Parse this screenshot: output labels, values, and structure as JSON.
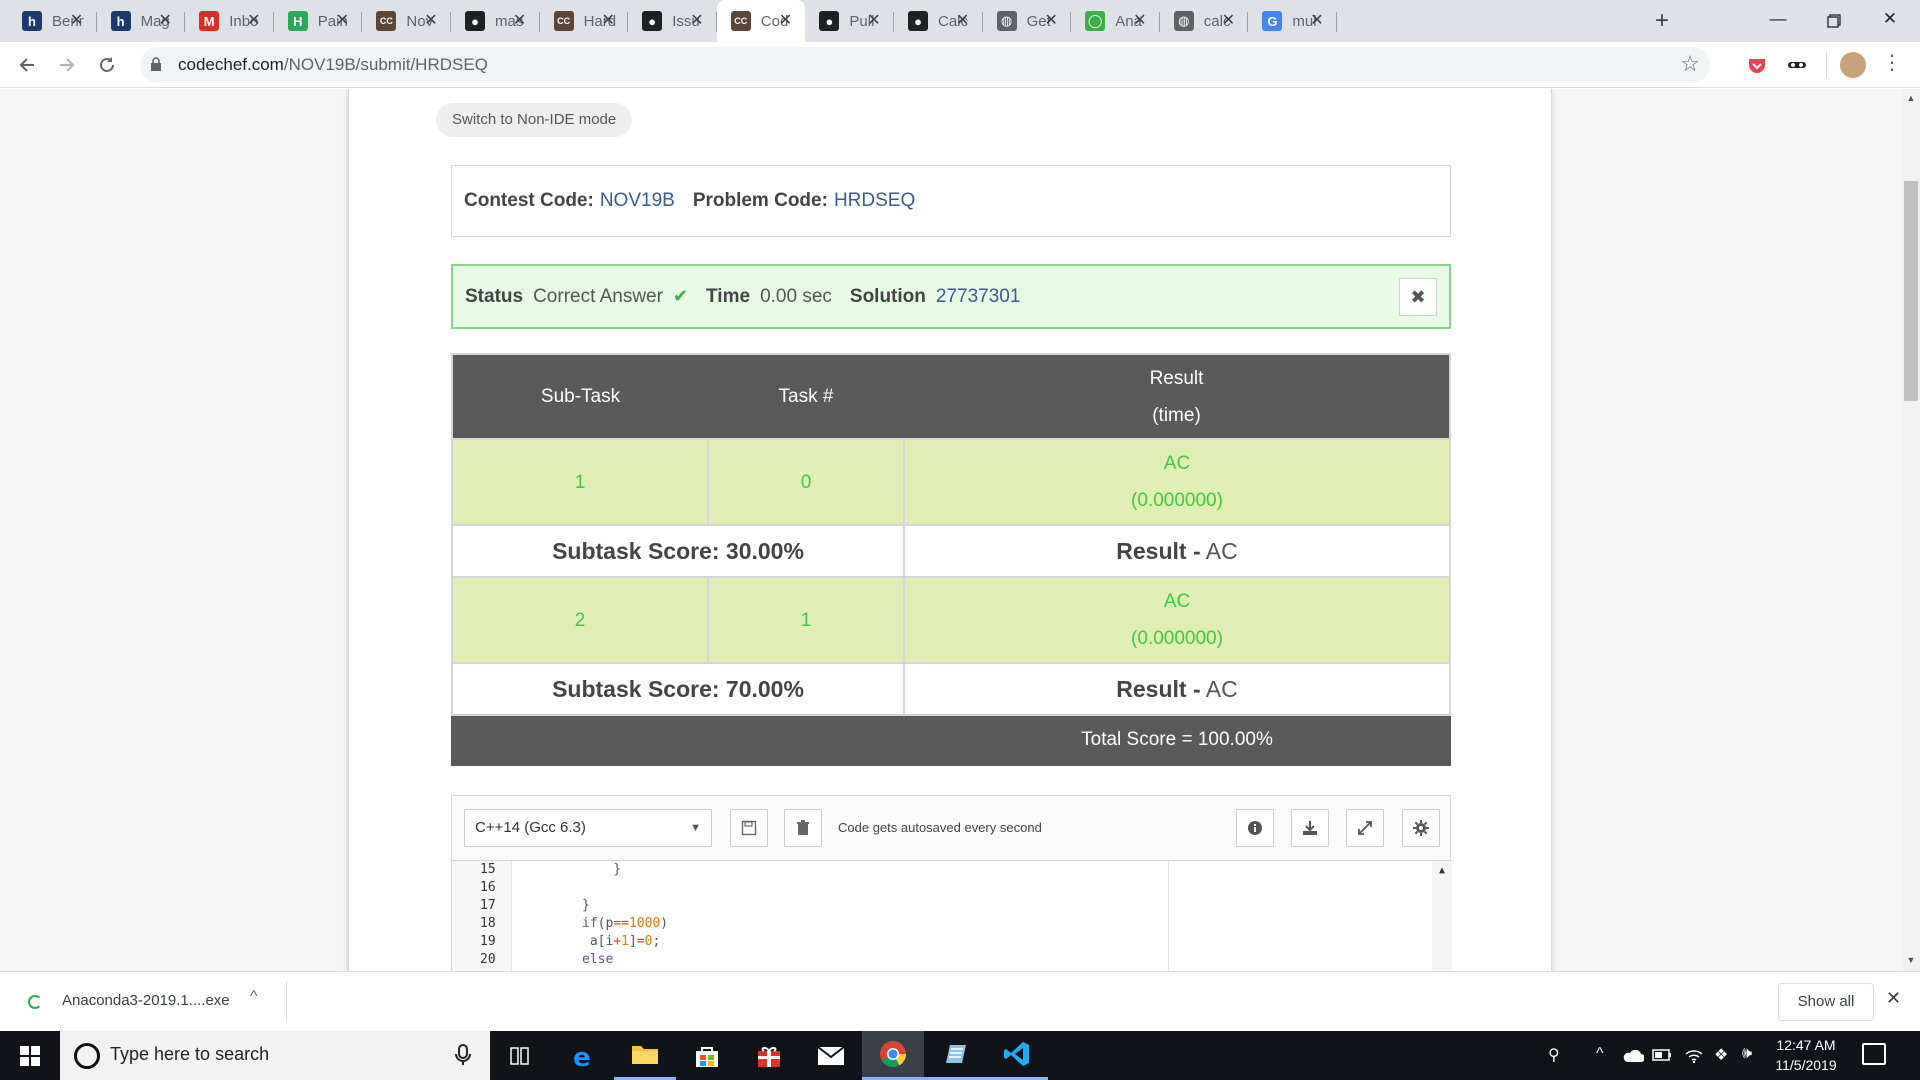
{
  "browser": {
    "tabs": [
      {
        "title": "Benn",
        "icon": "hashnode-icon",
        "color": "#1a3a6e"
      },
      {
        "title": "Mag",
        "icon": "hashnode-icon",
        "color": "#1a3a6e"
      },
      {
        "title": "Inbo",
        "icon": "gmail-icon",
        "color": "#d93025"
      },
      {
        "title": "Pain",
        "icon": "h-icon",
        "color": "#2ca85a"
      },
      {
        "title": "Nov",
        "icon": "codechef-icon",
        "color": "#5b4638"
      },
      {
        "title": "mas",
        "icon": "github-icon",
        "color": "#202124"
      },
      {
        "title": "Hard",
        "icon": "codechef-icon",
        "color": "#5b4638"
      },
      {
        "title": "Issu",
        "icon": "github-icon",
        "color": "#202124"
      },
      {
        "title": "Cod",
        "icon": "codechef-icon",
        "color": "#5b4638",
        "active": true
      },
      {
        "title": "Pull",
        "icon": "github-icon",
        "color": "#202124"
      },
      {
        "title": "Calc",
        "icon": "github-icon",
        "color": "#202124"
      },
      {
        "title": "Get",
        "icon": "globe-icon",
        "color": "#5f6368"
      },
      {
        "title": "Ana",
        "icon": "anaconda-icon",
        "color": "#3eb049"
      },
      {
        "title": "calc",
        "icon": "globe-icon",
        "color": "#5f6368"
      },
      {
        "title": "mul",
        "icon": "google-icon",
        "color": "#4285f4"
      }
    ],
    "url_host": "codechef.com",
    "url_path": "/NOV19B/submit/HRDSEQ"
  },
  "page": {
    "switch_mode": "Switch to Non-IDE mode",
    "contest_label": "Contest Code:",
    "contest_value": "NOV19B",
    "problem_label": "Problem Code:",
    "problem_value": "HRDSEQ",
    "status_label": "Status",
    "status_value": "Correct Answer",
    "time_label": "Time",
    "time_value": "0.00 sec",
    "solution_label": "Solution",
    "solution_value": "27737301",
    "close": "✖"
  },
  "results": {
    "headers": {
      "subtask": "Sub-Task",
      "task": "Task #",
      "result_line1": "Result",
      "result_line2": "(time)"
    },
    "rows": [
      {
        "subtask": "1",
        "task": "0",
        "result": "AC",
        "time": "(0.000000)",
        "score_label": "Subtask Score: 30.00%",
        "result_label": "Result -",
        "result_value": "AC"
      },
      {
        "subtask": "2",
        "task": "1",
        "result": "AC",
        "time": "(0.000000)",
        "score_label": "Subtask Score: 70.00%",
        "result_label": "Result -",
        "result_value": "AC"
      }
    ],
    "total": "Total Score = 100.00%"
  },
  "editor": {
    "language": "C++14 (Gcc 6.3)",
    "autosave": "Code gets autosaved every second",
    "lines": [
      {
        "n": "15",
        "code": "    }"
      },
      {
        "n": "16",
        "code": ""
      },
      {
        "n": "17",
        "code": "}"
      },
      {
        "n": "18",
        "code": "if(p==1000)"
      },
      {
        "n": "19",
        "code": " a[i+1]=0;"
      },
      {
        "n": "20",
        "code": "else"
      }
    ]
  },
  "downloads": {
    "file": "Anaconda3-2019.1....exe",
    "show_all": "Show all"
  },
  "taskbar": {
    "search_placeholder": "Type here to search",
    "time": "12:47 AM",
    "date": "11/5/2019"
  }
}
